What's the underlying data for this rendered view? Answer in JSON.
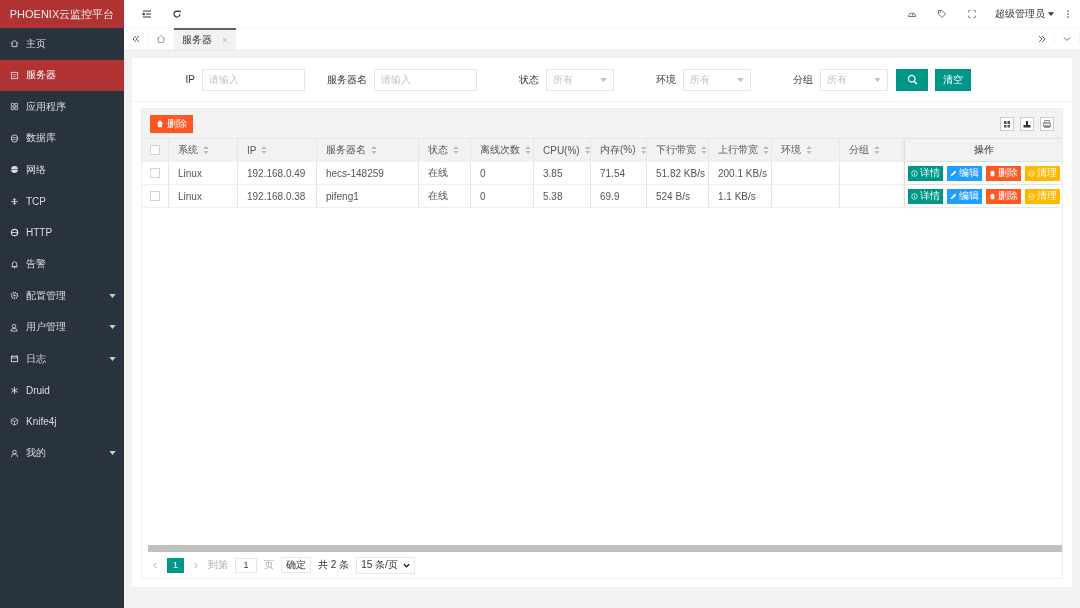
{
  "app_title": "PHOENIX云监控平台",
  "sidebar": {
    "items": [
      {
        "label": "主页",
        "selected": false,
        "expandable": false
      },
      {
        "label": "服务器",
        "selected": true,
        "expandable": false
      },
      {
        "label": "应用程序",
        "selected": false,
        "expandable": false
      },
      {
        "label": "数据库",
        "selected": false,
        "expandable": false
      },
      {
        "label": "网络",
        "selected": false,
        "expandable": false
      },
      {
        "label": "TCP",
        "selected": false,
        "expandable": false
      },
      {
        "label": "HTTP",
        "selected": false,
        "expandable": false
      },
      {
        "label": "告警",
        "selected": false,
        "expandable": false
      },
      {
        "label": "配置管理",
        "selected": false,
        "expandable": true
      },
      {
        "label": "用户管理",
        "selected": false,
        "expandable": true
      },
      {
        "label": "日志",
        "selected": false,
        "expandable": true
      },
      {
        "label": "Druid",
        "selected": false,
        "expandable": false
      },
      {
        "label": "Knife4j",
        "selected": false,
        "expandable": false
      },
      {
        "label": "我的",
        "selected": false,
        "expandable": true
      }
    ]
  },
  "header": {
    "user": "超级管理员"
  },
  "tabs": [
    {
      "label": "服务器",
      "selected": true,
      "close": "×"
    }
  ],
  "filters": [
    {
      "label": "IP",
      "kind": "input",
      "placeholder": "请输入"
    },
    {
      "label": "服务器名",
      "kind": "input",
      "placeholder": "请输入"
    },
    {
      "label": "状态",
      "kind": "select",
      "placeholder": "所有"
    },
    {
      "label": "环境",
      "kind": "select",
      "placeholder": "所有"
    },
    {
      "label": "分组",
      "kind": "select",
      "placeholder": "所有"
    }
  ],
  "clear_button": "清空",
  "delete_button": "删除",
  "table": {
    "select_all_checked": false,
    "columns": [
      {
        "label": "系统",
        "sortable": true
      },
      {
        "label": "IP",
        "sortable": true
      },
      {
        "label": "服务器名",
        "sortable": true
      },
      {
        "label": "状态",
        "sortable": true
      },
      {
        "label": "离线次数",
        "sortable": true
      },
      {
        "label": "CPU(%)",
        "sortable": true
      },
      {
        "label": "内存(%)",
        "sortable": true
      },
      {
        "label": "下行带宽",
        "sortable": true
      },
      {
        "label": "上行带宽",
        "sortable": true
      },
      {
        "label": "环境",
        "sortable": true
      },
      {
        "label": "分组",
        "sortable": true
      },
      {
        "label": "操作",
        "sortable": false
      }
    ],
    "rows": [
      {
        "checked": false,
        "cells": [
          "Linux",
          "192.168.0.49",
          "hecs-148259",
          "在线",
          "0",
          "3.85",
          "71.54",
          "51.82 KB/s",
          "200.1 KB/s",
          "",
          ""
        ],
        "actions": [
          {
            "label": "详情",
            "kind": "info",
            "color": "#009688"
          },
          {
            "label": "编辑",
            "kind": "edit",
            "color": "#1e9fff"
          },
          {
            "label": "删除",
            "kind": "delete",
            "color": "#ff5722"
          },
          {
            "label": "清理",
            "kind": "clean",
            "color": "#ffb800"
          }
        ]
      },
      {
        "checked": false,
        "cells": [
          "Linux",
          "192.168.0.38",
          "pifeng1",
          "在线",
          "0",
          "5.38",
          "69.9",
          "524 B/s",
          "1.1 KB/s",
          "",
          ""
        ],
        "actions": [
          {
            "label": "详情",
            "kind": "info",
            "color": "#009688"
          },
          {
            "label": "编辑",
            "kind": "edit",
            "color": "#1e9fff"
          },
          {
            "label": "删除",
            "kind": "delete",
            "color": "#ff5722"
          },
          {
            "label": "清理",
            "kind": "clean",
            "color": "#ffb800"
          }
        ]
      }
    ]
  },
  "pagination": {
    "prev": "‹",
    "current": "1",
    "next": "›",
    "goto_label": "到第",
    "page_value": "1",
    "page_unit": "页",
    "confirm": "确定",
    "total": "共 2 条",
    "page_size": "15 条/页"
  }
}
